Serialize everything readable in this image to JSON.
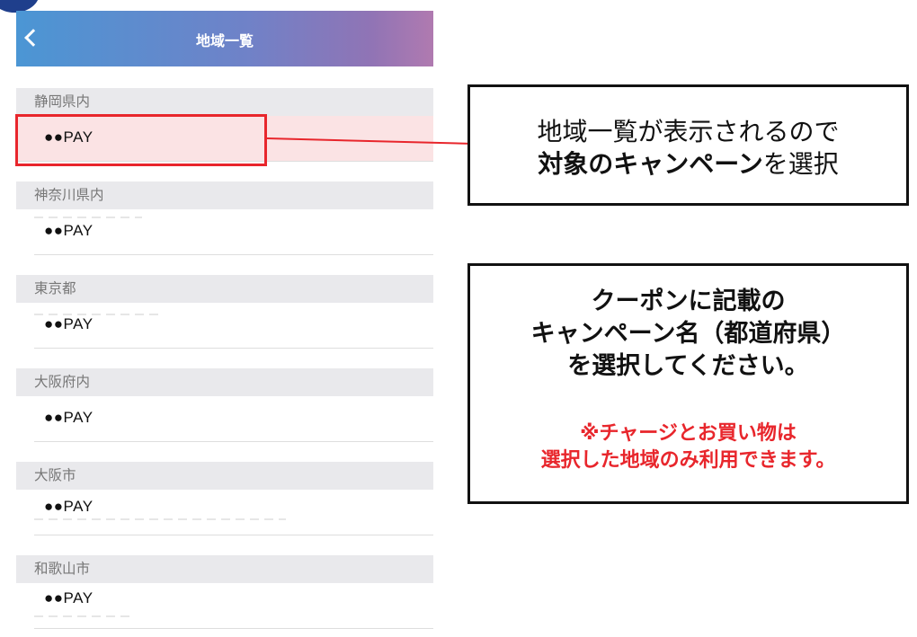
{
  "nav": {
    "title": "地域一覧"
  },
  "sections": [
    {
      "header": "静岡県内",
      "item": "●●PAY"
    },
    {
      "header": "神奈川県内",
      "item": "●●PAY"
    },
    {
      "header": "東京都",
      "item": "●●PAY"
    },
    {
      "header": "大阪府内",
      "item": "●●PAY"
    },
    {
      "header": "大阪市",
      "item": "●●PAY"
    },
    {
      "header": "和歌山市",
      "item": "●●PAY"
    }
  ],
  "callout1": {
    "line1": "地域一覧が表示されるので",
    "line2_bold": "対象のキャンペーン",
    "line2_rest": "を選択"
  },
  "callout2": {
    "line1": "クーポンに記載の",
    "line2": "キャンペーン名（都道府県）",
    "line3": "を選択してください。",
    "warn1": "※チャージとお買い物は",
    "warn2": "選択した地域のみ利用できます。"
  },
  "colors": {
    "accent_red": "#e8262c",
    "highlight_bg": "#fbe3e4",
    "header_gradient_start": "#4b96d4",
    "header_gradient_end": "#b07ab0"
  }
}
